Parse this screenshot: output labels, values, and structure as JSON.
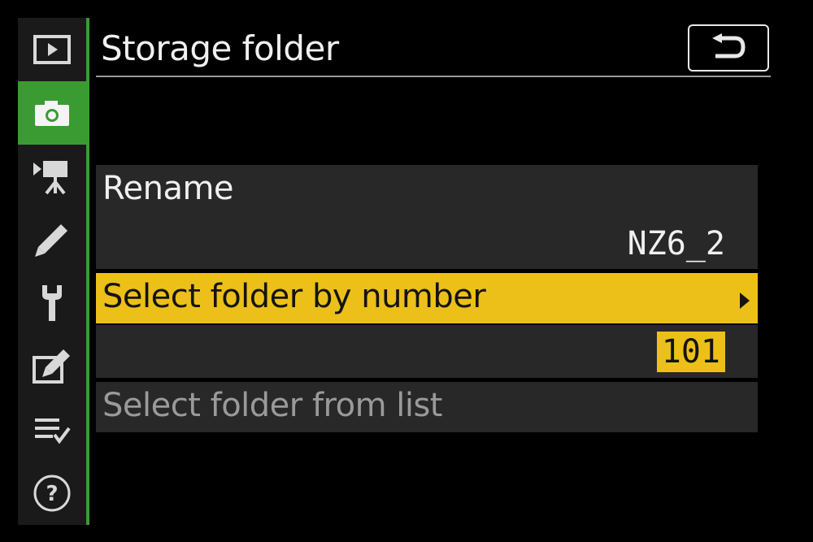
{
  "header": {
    "title": "Storage folder"
  },
  "sidebar": {
    "items": [
      {
        "icon": "playback-icon",
        "active": false
      },
      {
        "icon": "camera-icon",
        "active": true
      },
      {
        "icon": "movie-camera-icon",
        "active": false
      },
      {
        "icon": "pencil-icon",
        "active": false
      },
      {
        "icon": "wrench-icon",
        "active": false
      },
      {
        "icon": "retouch-icon",
        "active": false
      },
      {
        "icon": "my-menu-icon",
        "active": false
      },
      {
        "icon": "help-icon",
        "active": false
      }
    ],
    "accent_color": "#3a9b32"
  },
  "menu": {
    "rename": {
      "label": "Rename",
      "value": "NZ6_2"
    },
    "select_by_number": {
      "label": "Select folder by number",
      "value": "101"
    },
    "select_from_list": {
      "label": "Select folder from list"
    }
  },
  "colors": {
    "highlight": "#ecc019",
    "row_bg": "#282828"
  }
}
